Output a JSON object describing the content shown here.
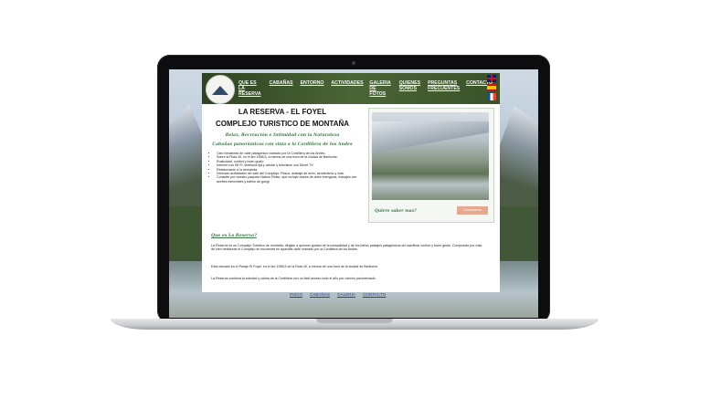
{
  "header": {
    "nav": [
      "QUE ES LA RESERVA",
      "CABAÑAS",
      "ENTORNO",
      "ACTIVIDADES",
      "GALERIA DE FOTOS",
      "QUIENES SOMOS",
      "PREGUNTAS FRECUENTES",
      "CONTACTO"
    ],
    "flags": [
      "uk-flag-icon",
      "spain-flag-icon",
      "france-flag-icon"
    ]
  },
  "main": {
    "title_line1": "LA RESERVA - EL FOYEL",
    "title_line2": "COMPLEJO TURISTICO DE MONTAÑA",
    "tagline1": "Relax, Recreación e Intimidad con la Naturaleza",
    "tagline2": "Cabañas panorámicas con vista a la Cordillera de los Andes",
    "features": [
      "Cien hectáreas de valle patagónico rodeado por la Cordillera de los Andes.",
      "Sobre la Ruta 40, en el km 1958,5, a menos de una hora de la ciudad de Bariloche.",
      "Rusticidad, confort y buen gusto.",
      "Internet con WI FI, telefonía fija y celular y televisión con Direct TV.",
      "Restauración a la demanda.",
      "Diversas actividades sin salir del Complejo: Pesca, avistaje de aves, senderismo y más.",
      "Consulte por nuestro paquete Naturo Relax, que incluye clases de artes energicas, masajes con aceites esenciales y baños de gong!"
    ],
    "photo_caption": "Quiere saber mas?",
    "contact_button": "Contactenos",
    "section_title": "Que es La Reserva?",
    "paragraphs": [
      "La Reserva es un Complejo Turistico de montaña, dirigido a quienes gustan de la tranquilidad y de los bellos paisajes patagónicos sin sacrificar confort y buen gusto. Compuesto por más de cien hectáreas el Complejo se encuentra en apacible valle rodeado por la Cordillera de los Andes.",
      "Está ubicado en el Paraje El Foyel, en el km 1958,5 de la Ruta 40, a menos de una hora de la ciudad de Bariloche.",
      "La Reserva combina la soledad y calma de la Cordillera con un fácil acceso todo el año por camino pavimentado."
    ]
  },
  "footer": {
    "links": [
      "INICIO",
      "CABAÑAS",
      "GALERIA",
      "CONTACTO"
    ]
  }
}
